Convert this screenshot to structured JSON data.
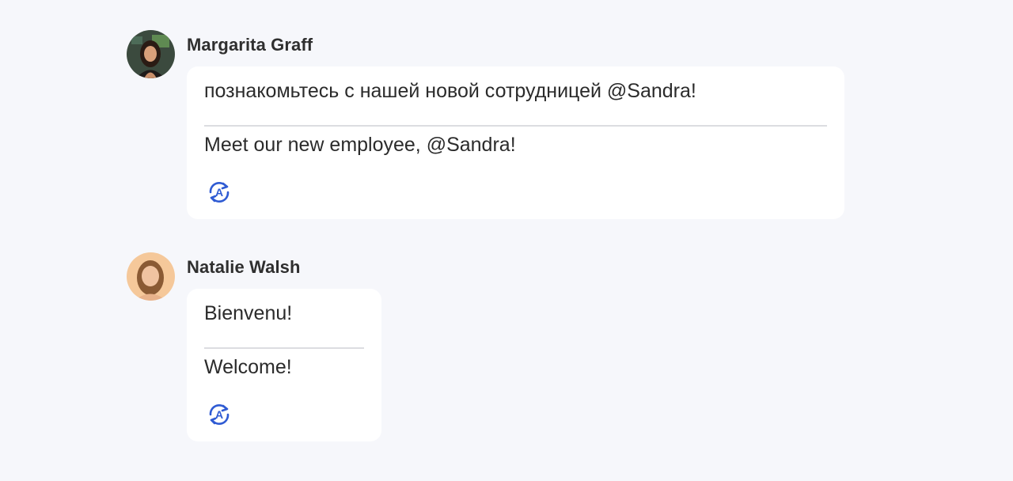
{
  "messages": [
    {
      "author": "Margarita Graff",
      "avatar_icon": "avatar-margarita",
      "original_text": "познакомьтесь с нашей новой сотрудницей @Sandra!",
      "translated_text": "Meet our new employee, @Sandra!",
      "translate_icon": "translate-icon"
    },
    {
      "author": "Natalie Walsh",
      "avatar_icon": "avatar-natalie",
      "original_text": "Bienvenu!",
      "translated_text": "Welcome!",
      "translate_icon": "translate-icon"
    }
  ],
  "colors": {
    "background": "#f6f7fb",
    "bubble": "#ffffff",
    "accent": "#2f5bd3",
    "text": "#2b2b2b",
    "divider": "#dcdde1"
  }
}
